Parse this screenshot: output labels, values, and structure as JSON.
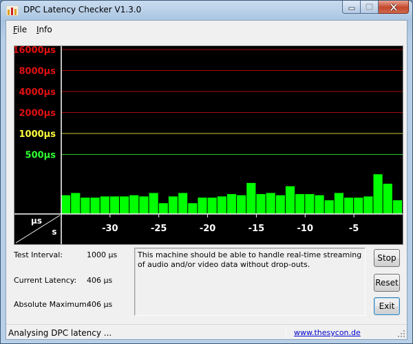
{
  "window": {
    "title": "DPC Latency Checker V1.3.0",
    "icon": "app-bars-icon"
  },
  "menu": {
    "items": [
      {
        "label": "File",
        "accel": "F",
        "rest": "ile"
      },
      {
        "label": "Info",
        "accel": "I",
        "rest": "nfo"
      }
    ]
  },
  "graph": {
    "y_axis_label": "µs",
    "x_axis_label": "s",
    "y_ticks": [
      {
        "label": "16000µs",
        "color": "#e01010"
      },
      {
        "label": "8000µs",
        "color": "#e01010"
      },
      {
        "label": "4000µs",
        "color": "#e01010"
      },
      {
        "label": "2000µs",
        "color": "#e01010"
      },
      {
        "label": "1000µs",
        "color": "#ffff40"
      },
      {
        "label": "500µs",
        "color": "#30ff30"
      }
    ],
    "x_ticks": [
      "-30",
      "-25",
      "-20",
      "-15",
      "-10",
      "-5"
    ],
    "bar_color": "#00ff00",
    "background": "#000000"
  },
  "chart_data": {
    "type": "bar",
    "title": "",
    "xlabel": "s",
    "ylabel": "µs",
    "y_scale": "log",
    "x": [
      -34,
      -33,
      -32,
      -31,
      -30,
      -29,
      -28,
      -27,
      -26,
      -25,
      -24,
      -23,
      -22,
      -21,
      -20,
      -19,
      -18,
      -17,
      -16,
      -15,
      -14,
      -13,
      -12,
      -11,
      -10,
      -9,
      -8,
      -7,
      -6,
      -5,
      -4,
      -3,
      -2,
      -1
    ],
    "values": [
      130,
      140,
      120,
      120,
      125,
      125,
      125,
      130,
      125,
      140,
      100,
      125,
      140,
      100,
      120,
      120,
      125,
      135,
      130,
      195,
      135,
      140,
      130,
      175,
      135,
      135,
      130,
      110,
      140,
      120,
      120,
      125,
      260,
      190,
      110
    ],
    "ylim": [
      70,
      16000
    ],
    "xlim": [
      -35,
      0
    ]
  },
  "info": {
    "test_interval_label": "Test Interval:",
    "test_interval_value": "1000 µs",
    "current_latency_label": "Current Latency:",
    "current_latency_value": "406 µs",
    "absolute_max_label": "Absolute Maximum:",
    "absolute_max_value": "406 µs"
  },
  "message": "This machine should be able to handle real-time streaming of audio and/or video data without drop-outs.",
  "buttons": {
    "stop": "Stop",
    "reset": "Reset",
    "exit": "Exit"
  },
  "status": {
    "text": "Analysing DPC latency ...",
    "link": "www.thesycon.de"
  }
}
